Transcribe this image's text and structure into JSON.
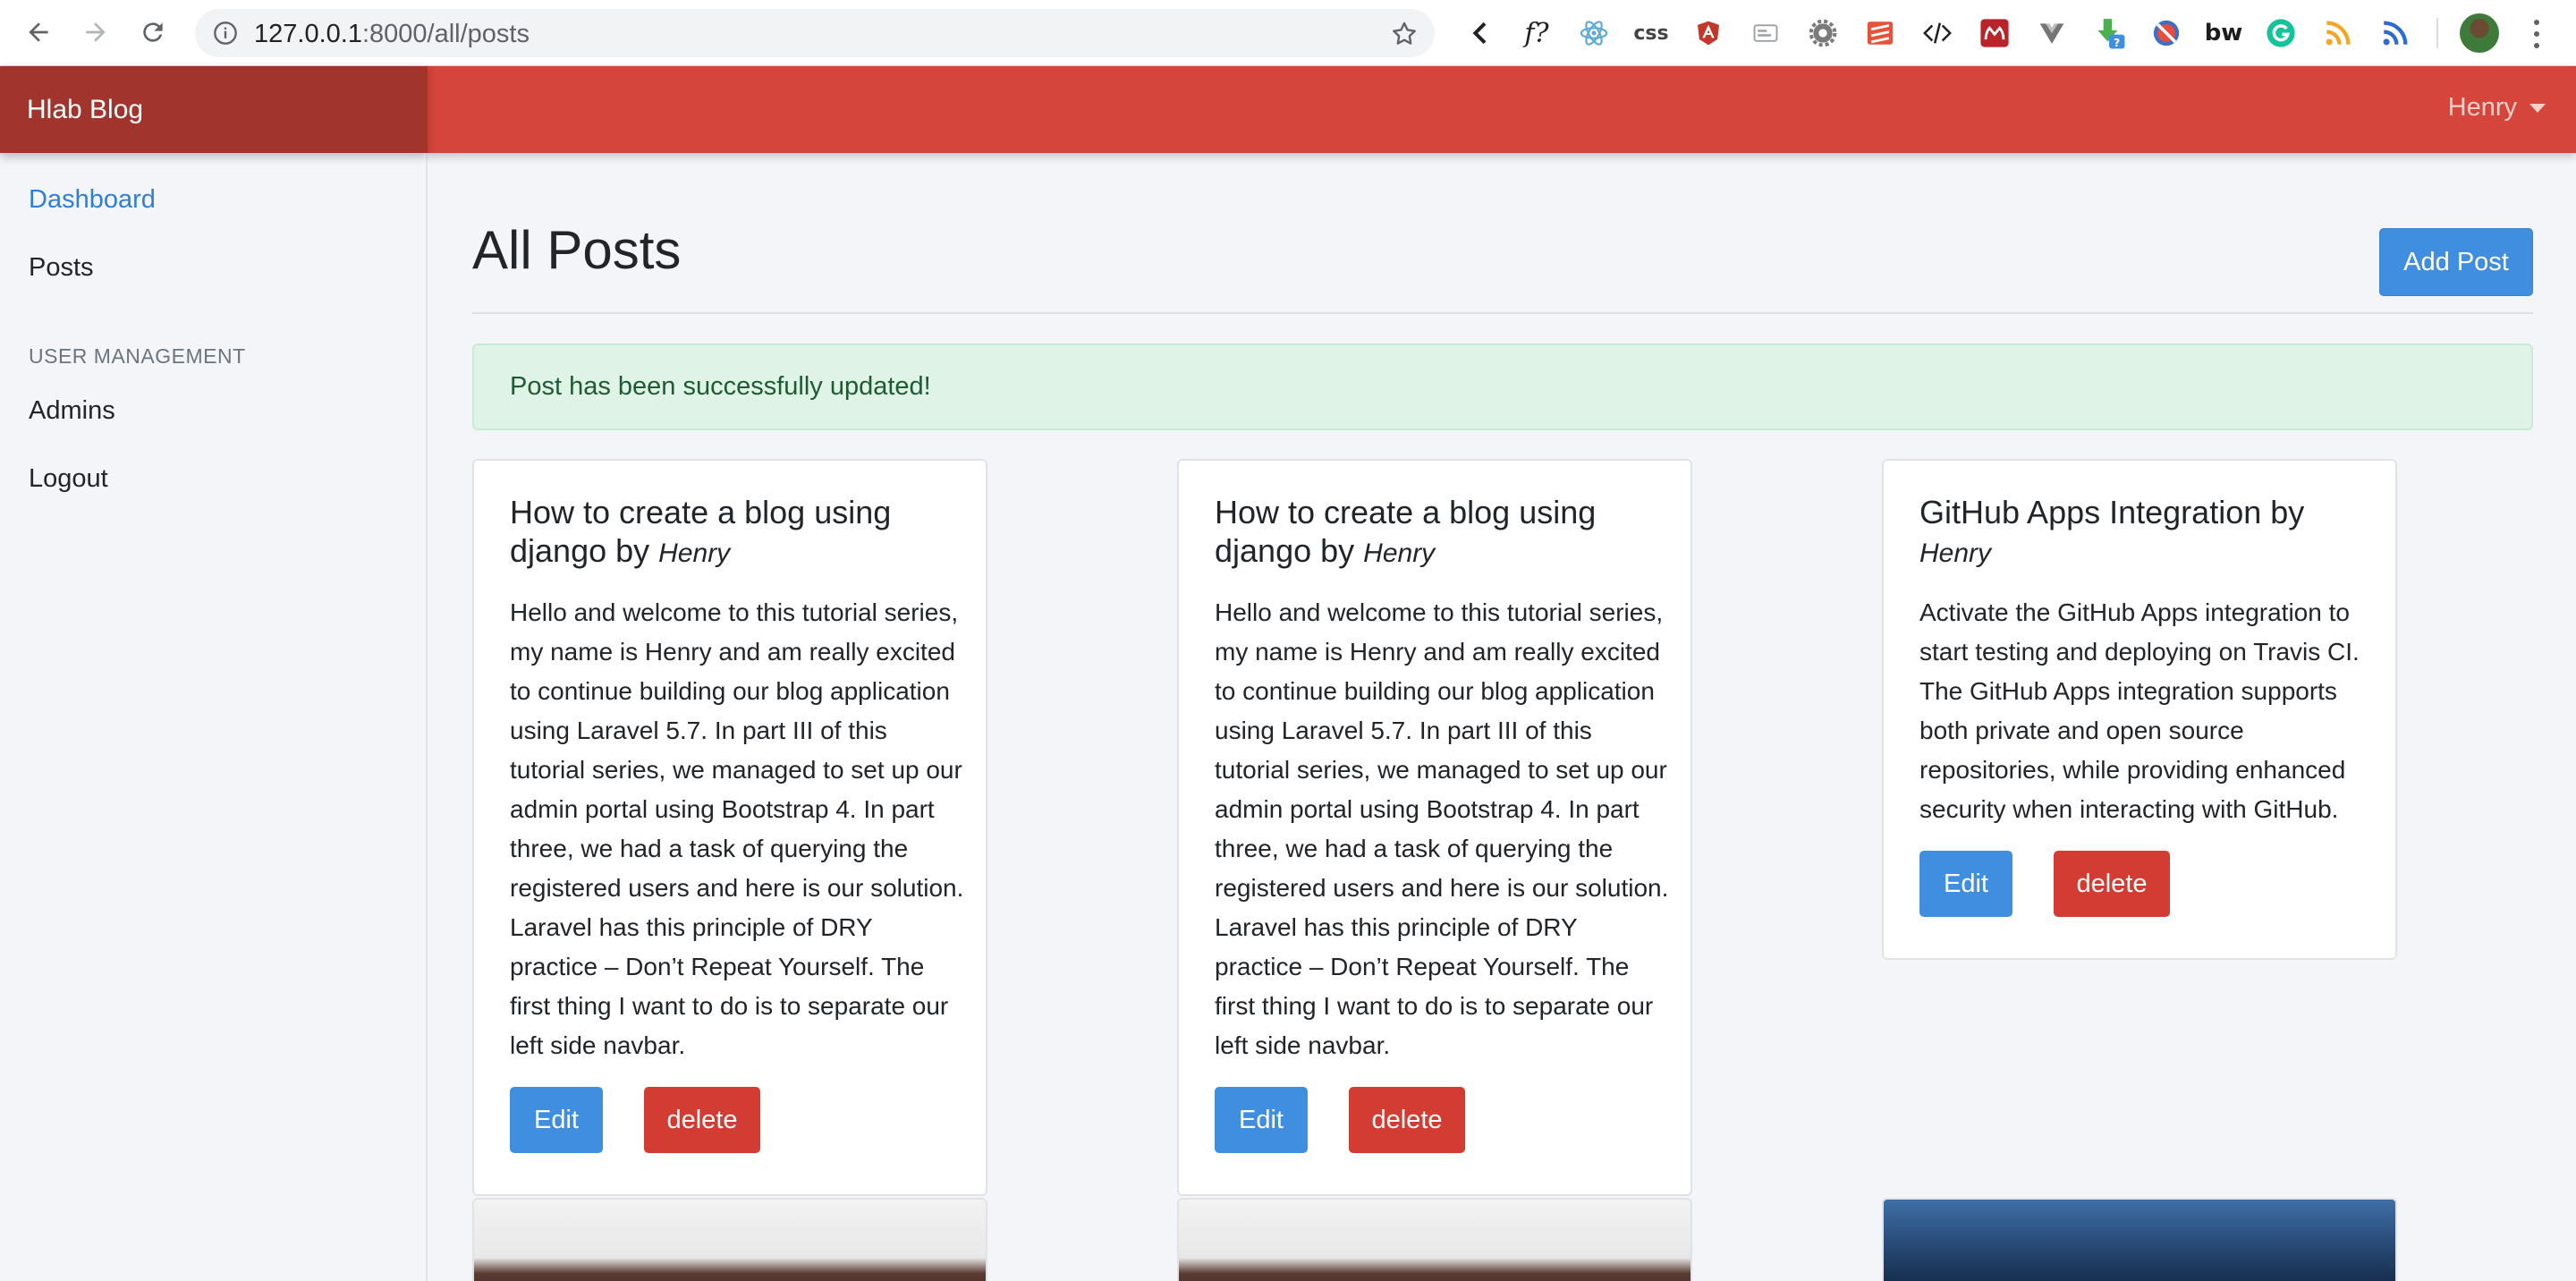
{
  "browser": {
    "url_host": "127.0.0.1",
    "url_rest": ":8000/all/posts",
    "extensions": [
      {
        "icon": "back-chevron-icon",
        "color": "#202124"
      },
      {
        "icon": "font-finder-icon",
        "label": "f?",
        "color": "#202124"
      },
      {
        "icon": "react-devtools-icon",
        "color": "#5aa9d6"
      },
      {
        "icon": "css-viewer-icon",
        "label": "css",
        "color": "#444444"
      },
      {
        "icon": "angular-icon",
        "color": "#c3362b"
      },
      {
        "icon": "json-viewer-icon",
        "color": "#9aa0a6"
      },
      {
        "icon": "settings-gear-icon",
        "color": "#7a7a7a"
      },
      {
        "icon": "layers-icon",
        "color": "#e4533a"
      },
      {
        "icon": "code-icon",
        "color": "#202124"
      },
      {
        "icon": "mendeley-icon",
        "color": "#b9242b"
      },
      {
        "icon": "vue-devtools-icon",
        "color": "#757575"
      },
      {
        "icon": "download-helper-icon",
        "color": "#4caf50"
      },
      {
        "icon": "no-script-icon",
        "color": "#3d6fc4"
      },
      {
        "icon": "builtwith-icon",
        "label": "bw",
        "color": "#1d1d1d"
      },
      {
        "icon": "grammarly-icon",
        "label": "G",
        "color": "#15c39a"
      },
      {
        "icon": "rss-icon",
        "color": "#f5a623"
      },
      {
        "icon": "rss-feed-icon",
        "color": "#2e6ad6"
      }
    ]
  },
  "app": {
    "brand": "Hlab Blog",
    "user": "Henry"
  },
  "sidebar": {
    "items": [
      {
        "label": "Dashboard"
      },
      {
        "label": "Posts"
      }
    ],
    "heading": "USER MANAGEMENT",
    "items2": [
      {
        "label": "Admins"
      },
      {
        "label": "Logout"
      }
    ]
  },
  "main": {
    "title": "All Posts",
    "add_button": "Add Post",
    "alert": "Post has been successfully updated!",
    "edit_label": "Edit",
    "delete_label": "delete",
    "posts": [
      {
        "title": "How to create a blog using django by",
        "author": "Henry",
        "body": "Hello and welcome to this tutorial series, my name is Henry and am really excited to continue building our blog application using Laravel 5.7. In part III of this tutorial series, we managed to set up our admin portal using Bootstrap 4. In part three, we had a task of querying the registered users and here is our solution. Laravel has this principle of DRY practice – Don’t Repeat Yourself. The first thing I want to do is to separate our left side navbar."
      },
      {
        "title": "How to create a blog using django by",
        "author": "Henry",
        "body": "Hello and welcome to this tutorial series, my name is Henry and am really excited to continue building our blog application using Laravel 5.7. In part III of this tutorial series, we managed to set up our admin portal using Bootstrap 4. In part three, we had a task of querying the registered users and here is our solution. Laravel has this principle of DRY practice – Don’t Repeat Yourself. The first thing I want to do is to separate our left side navbar."
      },
      {
        "title": "GitHub Apps Integration by",
        "author": "Henry",
        "body": "Activate the GitHub Apps integration to start testing and deploying on Travis CI. The GitHub Apps integration supports both private and open source repositories, while providing enhanced security when interacting with GitHub."
      }
    ]
  },
  "colors": {
    "topbar": "#d6453b",
    "brand_bg": "#a1352d",
    "primary": "#3f8ee0",
    "danger": "#d33c33",
    "alert_bg": "#dff3e6"
  }
}
